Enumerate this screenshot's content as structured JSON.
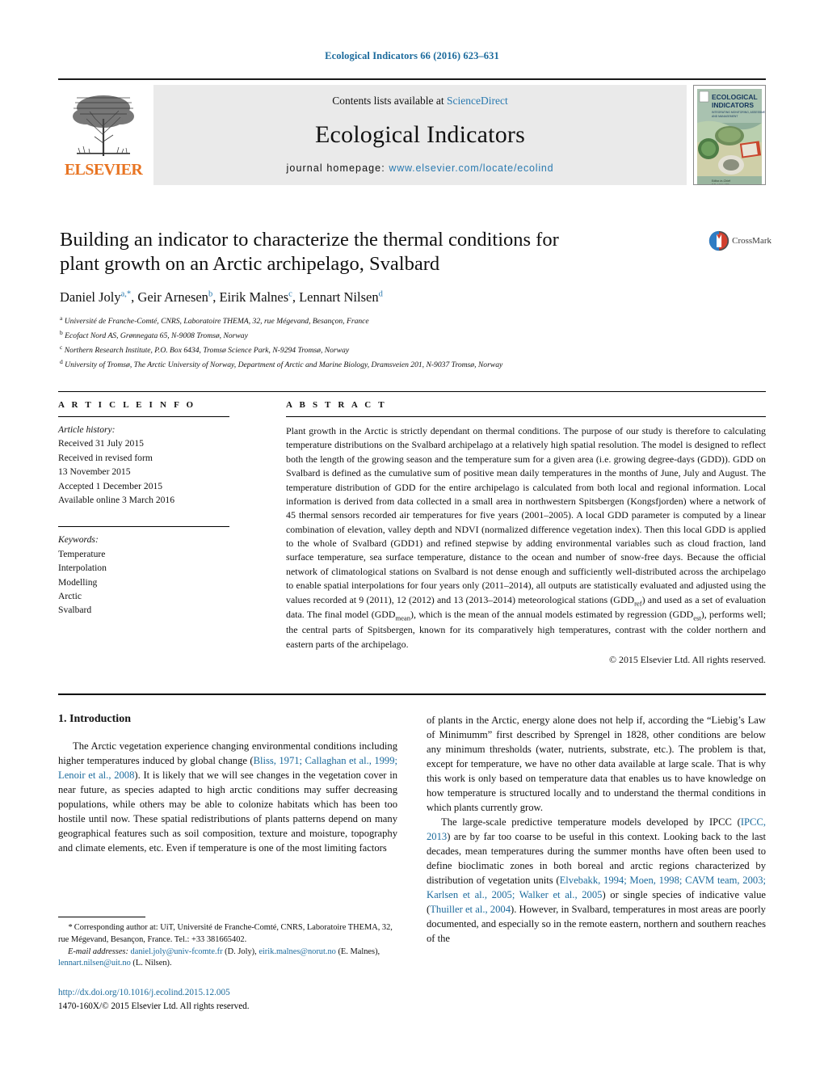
{
  "running_head": "Ecological Indicators 66 (2016) 623–631",
  "banner": {
    "publisher": "ELSEVIER",
    "contents_prefix": "Contents lists available at ",
    "sciencedirect": "ScienceDirect",
    "journal_title": "Ecological Indicators",
    "homepage_label": "journal homepage:",
    "homepage_url": "www.elsevier.com/locate/ecolind",
    "cover_title_line1": "ECOLOGICAL",
    "cover_title_line2": "INDICATORS",
    "cover_subtitle": "INTEGRATING MONITORING, ASSESSMENT AND MANAGEMENT"
  },
  "article": {
    "title": "Building an indicator to characterize the thermal conditions for plant growth on an Arctic archipelago, Svalbard",
    "authors_html": "Daniel Joly<sup>a,*</sup>, Geir Arnesen<sup>b</sup>, Eirik Malnes<sup>c</sup>, Lennart Nilsen<sup>d</sup>",
    "affiliations": [
      {
        "marker": "a",
        "text": "Université de Franche-Comté, CNRS, Laboratoire THEMA, 32, rue Mégevand, Besançon, France"
      },
      {
        "marker": "b",
        "text": "Ecofact Nord AS, Grønnegata 65, N-9008 Tromsø, Norway"
      },
      {
        "marker": "c",
        "text": "Northern Research Institute, P.O. Box 6434, Tromsø Science Park, N-9294 Tromsø, Norway"
      },
      {
        "marker": "d",
        "text": "University of Tromsø, The Arctic University of Norway, Department of Arctic and Marine Biology, Dramsveien 201, N-9037 Tromsø, Norway"
      }
    ],
    "crossmark_label": "CrossMark"
  },
  "article_info": {
    "heading": "A R T I C L E   I N F O",
    "history_label": "Article history:",
    "history": [
      "Received 31 July 2015",
      "Received in revised form",
      "13 November 2015",
      "Accepted 1 December 2015",
      "Available online 3 March 2016"
    ],
    "keywords_label": "Keywords:",
    "keywords": [
      "Temperature",
      "Interpolation",
      "Modelling",
      "Arctic",
      "Svalbard"
    ]
  },
  "abstract": {
    "heading": "A B S T R A C T",
    "text_html": "Plant growth in the Arctic is strictly dependant on thermal conditions. The purpose of our study is therefore to calculating temperature distributions on the Svalbard archipelago at a relatively high spatial resolution. The model is designed to reflect both the length of the growing season and the temperature sum for a given area (i.e. growing degree-days (GDD)). GDD on Svalbard is defined as the cumulative sum of positive mean daily temperatures in the months of June, July and August. The temperature distribution of GDD for the entire archipelago is calculated from both local and regional information. Local information is derived from data collected in a small area in northwestern Spitsbergen (Kongsfjorden) where a network of 45 thermal sensors recorded air temperatures for five years (2001–2005). A local GDD parameter is computed by a linear combination of elevation, valley depth and NDVI (normalized difference vegetation index). Then this local GDD is applied to the whole of Svalbard (GDD1) and refined stepwise by adding environmental variables such as cloud fraction, land surface temperature, sea surface temperature, distance to the ocean and number of snow-free days. Because the official network of climatological stations on Svalbard is not dense enough and sufficiently well-distributed across the archipelago to enable spatial interpolations for four years only (2011–2014), all outputs are statistically evaluated and adjusted using the values recorded at 9 (2011), 12 (2012) and 13 (2013–2014) meteorological stations (GDD<sub>ref</sub>) and used as a set of evaluation data. The final model (GDD<sub>mean</sub>), which is the mean of the annual models estimated by regression (GDD<sub>est</sub>), performs well; the central parts of Spitsbergen, known for its comparatively high temperatures, contrast with the colder northern and eastern parts of the archipelago.",
    "copyright": "© 2015 Elsevier Ltd. All rights reserved."
  },
  "introduction": {
    "heading": "1.  Introduction",
    "left_para1_html": "The Arctic vegetation experience changing environmental conditions including higher temperatures induced by global change (<span class=\"ref\">Bliss, 1971; Callaghan et al., 1999; Lenoir et al., 2008</span>). It is likely that we will see changes in the vegetation cover in near future, as species adapted to high arctic conditions may suffer decreasing populations, while others may be able to colonize habitats which has been too hostile until now. These spatial redistributions of plants patterns depend on many geographical features such as soil composition, texture and moisture, topography and climate elements, etc. Even if temperature is one of the most limiting factors",
    "right_para1_html": "of plants in the Arctic, energy alone does not help if, according the “Liebig’s Law of Minimumm” first described by Sprengel in 1828, other conditions are below any minimum thresholds (water, nutrients, substrate, etc.). The problem is that, except for temperature, we have no other data available at large scale. That is why this work is only based on temperature data that enables us to have knowledge on how temperature is structured locally and to understand the thermal conditions in which plants currently grow.",
    "right_para2_html": "The large-scale predictive temperature models developed by IPCC (<span class=\"ref\">IPCC, 2013</span>) are by far too coarse to be useful in this context. Looking back to the last decades, mean temperatures during the summer months have often been used to define bioclimatic zones in both boreal and arctic regions characterized by distribution of vegetation units (<span class=\"ref\">Elvebakk, 1994; Moen, 1998; CAVM team, 2003; Karlsen et al., 2005; Walker et al., 2005</span>) or single species of indicative value (<span class=\"ref\">Thuiller et al., 2004</span>). However, in Svalbard, temperatures in most areas are poorly documented, and especially so in the remote eastern, northern and southern reaches of the"
  },
  "footnote": {
    "corresponding_html": "<span class=\"fn-em\">*</span>  Corresponding author at: UiT, Université de Franche-Comté, CNRS, Laboratoire THEMA, 32, rue Mégevand, Besançon, France. Tel.: +33 381665402.",
    "emails_html": "<span class=\"fn-em\">E-mail addresses:</span> <span class=\"lnk\">daniel.joly@univ-fcomte.fr</span> (D. Joly), <span class=\"lnk\">eirik.malnes@norut.no</span> (E. Malnes), <span class=\"lnk\">lennart.nilsen@uit.no</span> (L. Nilsen).",
    "doi": "http://dx.doi.org/10.1016/j.ecolind.2015.12.005",
    "issn_line": "1470-160X/© 2015 Elsevier Ltd. All rights reserved."
  },
  "colors": {
    "link_blue": "#1b6a9c",
    "elsevier_orange": "#E87422",
    "banner_grey": "#eaeaea"
  }
}
